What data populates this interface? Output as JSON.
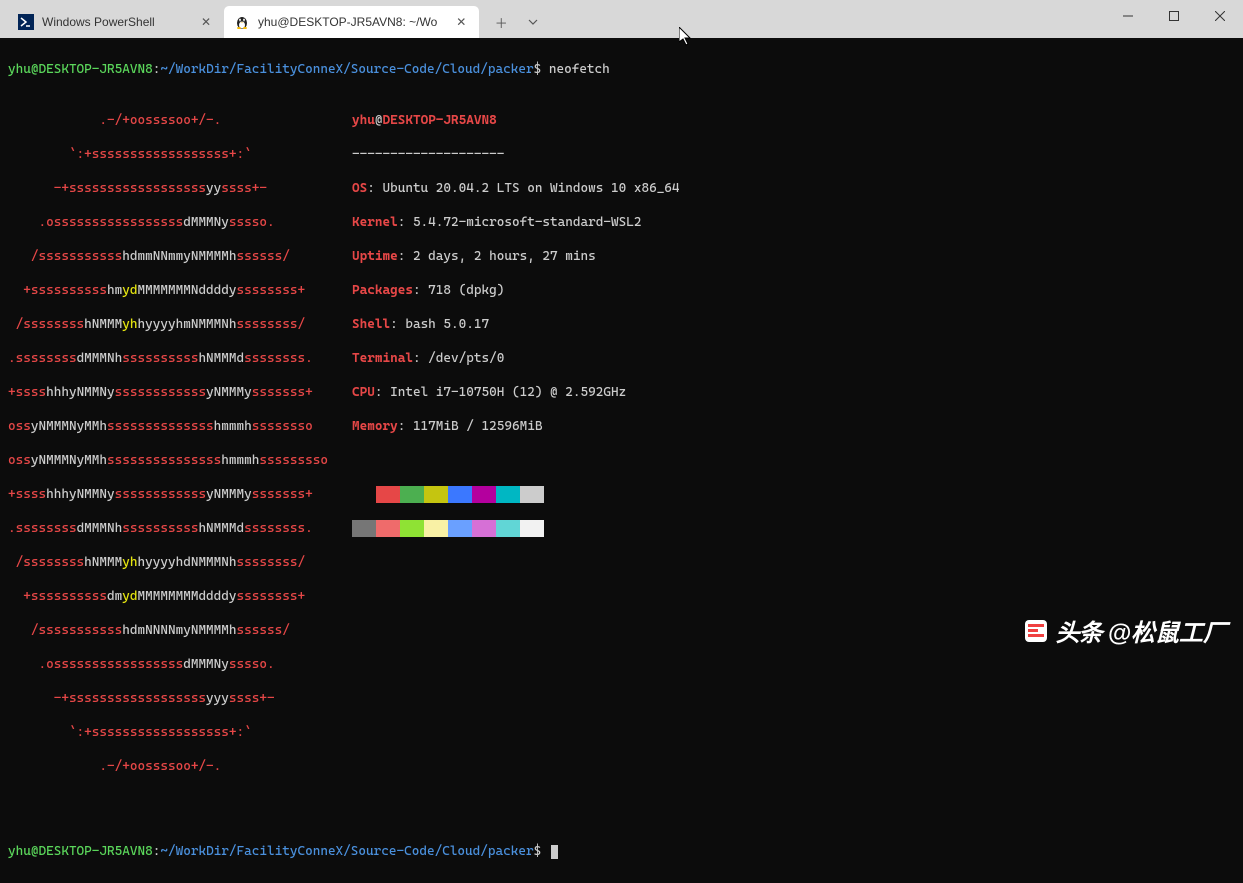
{
  "tabs": {
    "t0": {
      "title": "Windows PowerShell"
    },
    "t1": {
      "title": "yhu@DESKTOP-JR5AVN8: ~/Wo"
    }
  },
  "prompt": {
    "user": "yhu@DESKTOP-JR5AVN8",
    "sep": ":",
    "path": "~/WorkDir/FacilityConneX/Source-Code/Cloud/packer",
    "dollar": "$ ",
    "cmd": "neofetch"
  },
  "info": {
    "header_user": "yhu",
    "header_at": "@",
    "header_host": "DESKTOP-JR5AVN8",
    "sep": "--------------------",
    "os_label": "OS",
    "os_val": ": Ubuntu 20.04.2 LTS on Windows 10 x86_64",
    "kernel_label": "Kernel",
    "kernel_val": ": 5.4.72-microsoft-standard-WSL2",
    "uptime_label": "Uptime",
    "uptime_val": ": 2 days, 2 hours, 27 mins",
    "packages_label": "Packages",
    "packages_val": ": 718 (dpkg)",
    "shell_label": "Shell",
    "shell_val": ": bash 5.0.17",
    "terminal_label": "Terminal",
    "terminal_val": ": /dev/pts/0",
    "cpu_label": "CPU",
    "cpu_val": ": Intel i7-10750H (12) @ 2.592GHz",
    "memory_label": "Memory",
    "memory_val": ": 117MiB / 12596MiB"
  },
  "logo": {
    "l0_a": "            .-/+oossssoo+/-.",
    "l1_a": "        `:+ssssssssssssssssss+:`",
    "l2_a": "      -+ssssssssssssssssss",
    "l2_b": "yy",
    "l2_c": "ssss+-",
    "l3_a": "    .osssssssssssssssss",
    "l3_b": "dMMMNy",
    "l3_c": "sssso.",
    "l4_a": "   /sssssssssss",
    "l4_b": "hdmmNNmmyNMMMMh",
    "l4_c": "ssssss/",
    "l5_a": "  +ssssssssss",
    "l5_b": "hm",
    "l5_c": "yd",
    "l5_d": "MMMMMMMNddddy",
    "l5_e": "ssssssss+",
    "l6_a": " /ssssssss",
    "l6_b": "hNMMM",
    "l6_c": "yh",
    "l6_d": "hyyyyhmNMMMNh",
    "l6_e": "ssssssss/",
    "l7_a": ".ssssssss",
    "l7_b": "dMMMNh",
    "l7_c": "ssssssssss",
    "l7_d": "hNMMMd",
    "l7_e": "ssssssss.",
    "l8_a": "+ssss",
    "l8_b": "hhhyNMMNy",
    "l8_c": "ssssssssssss",
    "l8_d": "yNMMMy",
    "l8_e": "sssssss+",
    "l9_a": "oss",
    "l9_b": "yNMMMNyMMh",
    "l9_c": "ssssssssssssss",
    "l9_d": "hmmmh",
    "l9_e": "ssssssso",
    "l10_a": "oss",
    "l10_b": "yNMMMNyMMh",
    "l10_c": "sssssssssssssss",
    "l10_d": "hmmmh",
    "l10_e": "sssssssso",
    "l11_a": "+ssss",
    "l11_b": "hhhyNMMNy",
    "l11_c": "ssssssssssss",
    "l11_d": "yNMMMy",
    "l11_e": "sssssss+",
    "l12_a": ".ssssssss",
    "l12_b": "dMMMNh",
    "l12_c": "ssssssssss",
    "l12_d": "hNMMMd",
    "l12_e": "ssssssss.",
    "l13_a": " /ssssssss",
    "l13_b": "hNMMM",
    "l13_c": "yh",
    "l13_d": "hyyyyhdNMMMNh",
    "l13_e": "ssssssss/",
    "l14_a": "  +ssssssssss",
    "l14_b": "dm",
    "l14_c": "yd",
    "l14_d": "MMMMMMMMddddy",
    "l14_e": "ssssssss+",
    "l15_a": "   /sssssssssss",
    "l15_b": "hdmNNNNmyNMMMMh",
    "l15_c": "ssssss/",
    "l16_a": "    .osssssssssssssssss",
    "l16_b": "dMMMNy",
    "l16_c": "sssso.",
    "l17_a": "      -+ssssssssssssssssss",
    "l17_b": "yyy",
    "l17_c": "ssss+-",
    "l18_a": "        `:+ssssssssssssssssss+:`",
    "l19_a": "            .-/+oossssoo+/-."
  },
  "palette": {
    "row0": [
      "#0c0c0c",
      "#e64747",
      "#4caf50",
      "#c5c510",
      "#3b78ff",
      "#b4009e",
      "#00b7c3",
      "#cccccc"
    ],
    "row1": [
      "#767676",
      "#ef6b6b",
      "#8fe234",
      "#f9f1a5",
      "#6aa0ff",
      "#d670d6",
      "#61d6d6",
      "#f2f2f2"
    ]
  },
  "watermark": {
    "brand": "头条",
    "name": "@松鼠工厂"
  }
}
